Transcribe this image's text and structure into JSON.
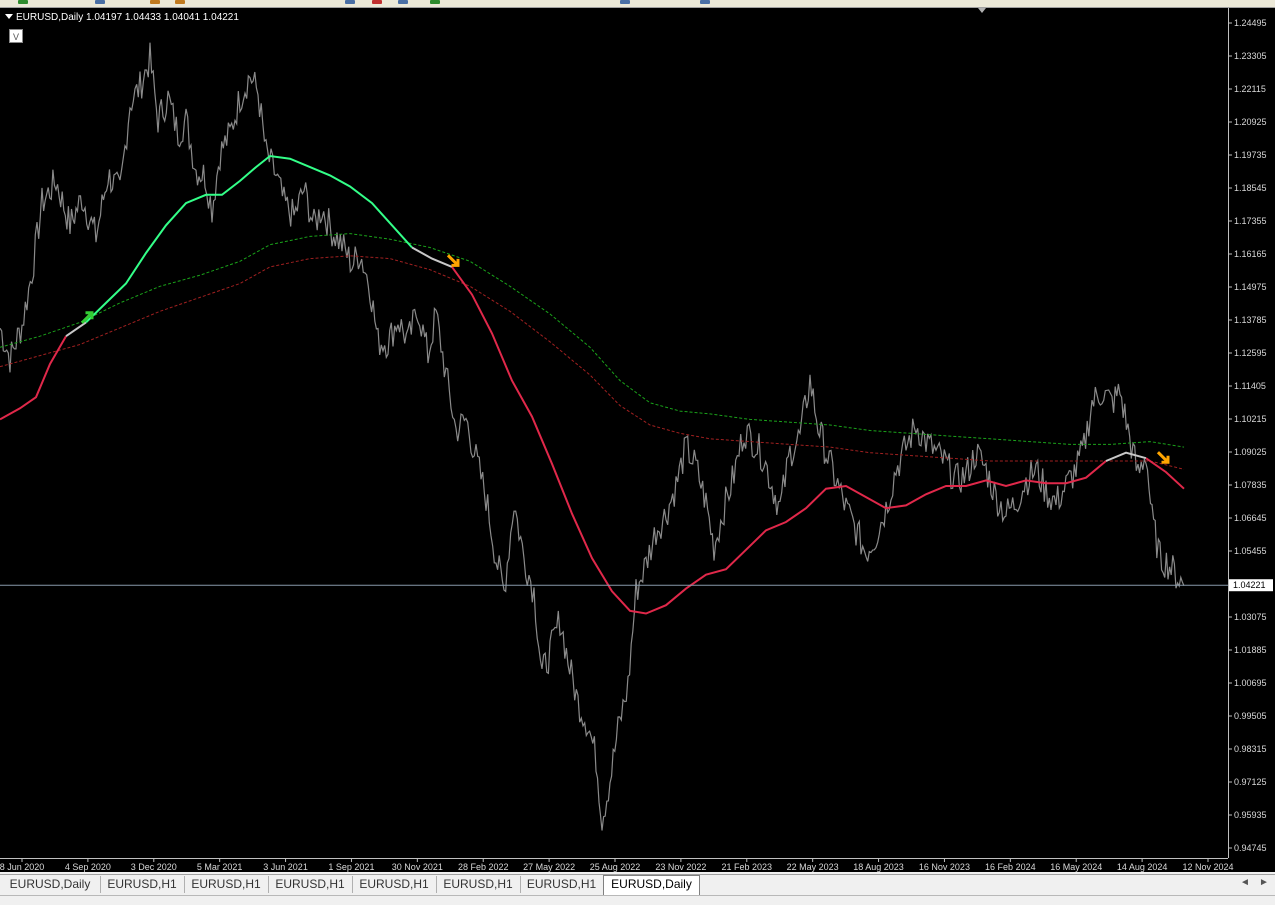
{
  "toolbar": {
    "icons": [
      {
        "name": "new-order-icon",
        "color": "#2e8b2e"
      },
      {
        "name": "open-chart-icon",
        "color": "#4a6fa5"
      },
      {
        "name": "profiles-icon",
        "color": "#c07a20"
      },
      {
        "name": "navigator-icon",
        "color": "#c07a20"
      },
      {
        "name": "market-watch-icon",
        "color": "#4a6fa5"
      },
      {
        "name": "data-window-icon",
        "color": "#c03030"
      },
      {
        "name": "terminal-icon",
        "color": "#4a6fa5"
      },
      {
        "name": "tester-icon",
        "color": "#2e8b2e"
      },
      {
        "name": "zoom-in-icon",
        "color": "#4a6fa5"
      },
      {
        "name": "zoom-out-icon",
        "color": "#4a6fa5"
      }
    ]
  },
  "chart": {
    "symbol_header": "EURUSD,Daily  1.04197 1.04433 1.04041 1.04221",
    "indicator_button": "V",
    "current_price_label": "1.04221",
    "colors": {
      "background": "#000000",
      "price": "#8a8a8a",
      "ma_up": "#33ff88",
      "ma_down": "#e0284a",
      "ma_neutral": "#c8c8c8",
      "band_upper": "#1aa31a",
      "band_lower": "#a02020",
      "current_line": "#8899aa",
      "arrow_up": "#33cc33",
      "arrow_down": "#ffa500"
    }
  },
  "chart_data": {
    "type": "line",
    "title": "EURUSD,Daily",
    "y_ticks": [
      "1.24495",
      "1.23305",
      "1.22115",
      "1.20925",
      "1.19735",
      "1.18545",
      "1.17355",
      "1.16165",
      "1.14975",
      "1.13785",
      "1.12595",
      "1.11405",
      "1.10215",
      "1.09025",
      "1.07835",
      "1.06645",
      "1.05455",
      "1.03075",
      "1.01885",
      "1.00695",
      "0.99505",
      "0.98315",
      "0.97125",
      "0.95935",
      "0.94745"
    ],
    "x_ticks": [
      "8 Jun 2020",
      "4 Sep 2020",
      "3 Dec 2020",
      "5 Mar 2021",
      "3 Jun 2021",
      "1 Sep 2021",
      "30 Nov 2021",
      "28 Feb 2022",
      "27 May 2022",
      "25 Aug 2022",
      "23 Nov 2022",
      "21 Feb 2023",
      "22 May 2023",
      "18 Aug 2023",
      "16 Nov 2023",
      "16 Feb 2024",
      "16 May 2024",
      "14 Aug 2024",
      "12 Nov 2024"
    ],
    "ylim": [
      0.94745,
      1.24495
    ],
    "last_close": 1.04221,
    "series": [
      {
        "values": [
          [
            0,
            1.135
          ],
          [
            10,
            1.124
          ],
          [
            22,
            1.136
          ],
          [
            32,
            1.155
          ],
          [
            42,
            1.18
          ],
          [
            56,
            1.188
          ],
          [
            70,
            1.172
          ],
          [
            82,
            1.182
          ],
          [
            96,
            1.168
          ],
          [
            108,
            1.19
          ],
          [
            120,
            1.184
          ],
          [
            130,
            1.216
          ],
          [
            140,
            1.222
          ],
          [
            150,
            1.232
          ],
          [
            158,
            1.21
          ],
          [
            168,
            1.218
          ],
          [
            178,
            1.205
          ],
          [
            186,
            1.21
          ],
          [
            196,
            1.192
          ],
          [
            205,
            1.19
          ],
          [
            212,
            1.178
          ],
          [
            220,
            1.198
          ],
          [
            230,
            1.205
          ],
          [
            240,
            1.218
          ],
          [
            250,
            1.226
          ],
          [
            258,
            1.22
          ],
          [
            266,
            1.198
          ],
          [
            276,
            1.19
          ],
          [
            284,
            1.18
          ],
          [
            294,
            1.175
          ],
          [
            304,
            1.185
          ],
          [
            314,
            1.172
          ],
          [
            322,
            1.178
          ],
          [
            332,
            1.17
          ],
          [
            342,
            1.165
          ],
          [
            352,
            1.158
          ],
          [
            360,
            1.162
          ],
          [
            370,
            1.15
          ],
          [
            378,
            1.13
          ],
          [
            388,
            1.13
          ],
          [
            398,
            1.138
          ],
          [
            408,
            1.13
          ],
          [
            418,
            1.142
          ],
          [
            428,
            1.125
          ],
          [
            436,
            1.14
          ],
          [
            446,
            1.118
          ],
          [
            456,
            1.098
          ],
          [
            466,
            1.102
          ],
          [
            476,
            1.088
          ],
          [
            486,
            1.074
          ],
          [
            496,
            1.052
          ],
          [
            504,
            1.04
          ],
          [
            514,
            1.072
          ],
          [
            524,
            1.052
          ],
          [
            534,
            1.04
          ],
          [
            542,
            1.01
          ],
          [
            550,
            1.018
          ],
          [
            560,
            1.03
          ],
          [
            568,
            1.015
          ],
          [
            578,
            1.0
          ],
          [
            588,
            0.992
          ],
          [
            596,
            0.98
          ],
          [
            602,
            0.958
          ],
          [
            610,
            0.972
          ],
          [
            618,
            0.99
          ],
          [
            628,
            1.006
          ],
          [
            636,
            1.04
          ],
          [
            646,
            1.05
          ],
          [
            656,
            1.062
          ],
          [
            666,
            1.068
          ],
          [
            676,
            1.078
          ],
          [
            686,
            1.092
          ],
          [
            696,
            1.085
          ],
          [
            706,
            1.072
          ],
          [
            714,
            1.056
          ],
          [
            724,
            1.07
          ],
          [
            734,
            1.082
          ],
          [
            744,
            1.098
          ],
          [
            754,
            1.094
          ],
          [
            764,
            1.088
          ],
          [
            772,
            1.078
          ],
          [
            780,
            1.07
          ],
          [
            790,
            1.09
          ],
          [
            800,
            1.096
          ],
          [
            810,
            1.116
          ],
          [
            818,
            1.1
          ],
          [
            826,
            1.09
          ],
          [
            836,
            1.08
          ],
          [
            846,
            1.07
          ],
          [
            856,
            1.062
          ],
          [
            866,
            1.054
          ],
          [
            876,
            1.06
          ],
          [
            886,
            1.07
          ],
          [
            896,
            1.084
          ],
          [
            906,
            1.092
          ],
          [
            916,
            1.1
          ],
          [
            926,
            1.094
          ],
          [
            936,
            1.09
          ],
          [
            946,
            1.086
          ],
          [
            956,
            1.08
          ],
          [
            966,
            1.082
          ],
          [
            976,
            1.09
          ],
          [
            986,
            1.084
          ],
          [
            996,
            1.074
          ],
          [
            1006,
            1.068
          ],
          [
            1016,
            1.072
          ],
          [
            1026,
            1.08
          ],
          [
            1036,
            1.084
          ],
          [
            1046,
            1.076
          ],
          [
            1056,
            1.072
          ],
          [
            1066,
            1.078
          ],
          [
            1076,
            1.084
          ],
          [
            1084,
            1.092
          ],
          [
            1092,
            1.108
          ],
          [
            1102,
            1.112
          ],
          [
            1112,
            1.108
          ],
          [
            1120,
            1.112
          ],
          [
            1128,
            1.098
          ],
          [
            1138,
            1.082
          ],
          [
            1146,
            1.09
          ],
          [
            1152,
            1.066
          ],
          [
            1160,
            1.052
          ],
          [
            1168,
            1.05
          ],
          [
            1176,
            1.046
          ],
          [
            1184,
            1.042
          ]
        ]
      },
      {
        "values": [
          [
            0,
            1.102
          ],
          [
            20,
            1.106
          ],
          [
            36,
            1.11
          ],
          [
            50,
            1.122
          ],
          [
            66,
            1.132
          ],
          [
            86,
            1.137
          ],
          [
            106,
            1.144
          ],
          [
            126,
            1.151
          ],
          [
            146,
            1.162
          ],
          [
            166,
            1.172
          ],
          [
            186,
            1.18
          ],
          [
            206,
            1.183
          ],
          [
            222,
            1.183
          ],
          [
            240,
            1.188
          ],
          [
            256,
            1.193
          ],
          [
            270,
            1.197
          ],
          [
            290,
            1.196
          ],
          [
            310,
            1.193
          ],
          [
            330,
            1.19
          ],
          [
            350,
            1.186
          ],
          [
            372,
            1.18
          ],
          [
            392,
            1.172
          ],
          [
            412,
            1.164
          ],
          [
            432,
            1.16
          ],
          [
            452,
            1.157
          ],
          [
            472,
            1.147
          ],
          [
            492,
            1.133
          ],
          [
            512,
            1.116
          ],
          [
            532,
            1.103
          ],
          [
            552,
            1.086
          ],
          [
            572,
            1.068
          ],
          [
            592,
            1.052
          ],
          [
            612,
            1.04
          ],
          [
            630,
            1.033
          ],
          [
            646,
            1.032
          ],
          [
            666,
            1.035
          ],
          [
            686,
            1.041
          ],
          [
            706,
            1.046
          ],
          [
            726,
            1.048
          ],
          [
            746,
            1.055
          ],
          [
            766,
            1.062
          ],
          [
            786,
            1.065
          ],
          [
            806,
            1.07
          ],
          [
            826,
            1.077
          ],
          [
            846,
            1.078
          ],
          [
            866,
            1.074
          ],
          [
            886,
            1.07
          ],
          [
            906,
            1.071
          ],
          [
            926,
            1.075
          ],
          [
            946,
            1.078
          ],
          [
            966,
            1.078
          ],
          [
            986,
            1.08
          ],
          [
            1006,
            1.078
          ],
          [
            1026,
            1.08
          ],
          [
            1046,
            1.079
          ],
          [
            1066,
            1.079
          ],
          [
            1086,
            1.081
          ],
          [
            1106,
            1.087
          ],
          [
            1126,
            1.09
          ],
          [
            1146,
            1.088
          ],
          [
            1166,
            1.083
          ],
          [
            1184,
            1.077
          ]
        ]
      },
      {
        "values": [
          [
            0,
            1.128
          ],
          [
            40,
            1.132
          ],
          [
            80,
            1.137
          ],
          [
            120,
            1.144
          ],
          [
            160,
            1.15
          ],
          [
            200,
            1.154
          ],
          [
            240,
            1.159
          ],
          [
            270,
            1.165
          ],
          [
            310,
            1.168
          ],
          [
            350,
            1.169
          ],
          [
            390,
            1.167
          ],
          [
            430,
            1.164
          ],
          [
            470,
            1.159
          ],
          [
            510,
            1.15
          ],
          [
            550,
            1.14
          ],
          [
            590,
            1.128
          ],
          [
            620,
            1.116
          ],
          [
            650,
            1.108
          ],
          [
            680,
            1.105
          ],
          [
            710,
            1.104
          ],
          [
            750,
            1.102
          ],
          [
            790,
            1.101
          ],
          [
            830,
            1.1
          ],
          [
            870,
            1.098
          ],
          [
            910,
            1.097
          ],
          [
            950,
            1.096
          ],
          [
            990,
            1.095
          ],
          [
            1030,
            1.094
          ],
          [
            1070,
            1.093
          ],
          [
            1110,
            1.093
          ],
          [
            1150,
            1.094
          ],
          [
            1184,
            1.092
          ]
        ]
      },
      {
        "values": [
          [
            0,
            1.121
          ],
          [
            40,
            1.125
          ],
          [
            80,
            1.129
          ],
          [
            120,
            1.135
          ],
          [
            160,
            1.141
          ],
          [
            200,
            1.146
          ],
          [
            240,
            1.151
          ],
          [
            270,
            1.157
          ],
          [
            310,
            1.16
          ],
          [
            350,
            1.161
          ],
          [
            390,
            1.16
          ],
          [
            430,
            1.156
          ],
          [
            470,
            1.15
          ],
          [
            510,
            1.141
          ],
          [
            550,
            1.13
          ],
          [
            590,
            1.118
          ],
          [
            620,
            1.107
          ],
          [
            650,
            1.1
          ],
          [
            680,
            1.097
          ],
          [
            710,
            1.095
          ],
          [
            750,
            1.094
          ],
          [
            790,
            1.093
          ],
          [
            830,
            1.092
          ],
          [
            870,
            1.09
          ],
          [
            910,
            1.089
          ],
          [
            950,
            1.088
          ],
          [
            990,
            1.087
          ],
          [
            1030,
            1.087
          ],
          [
            1070,
            1.087
          ],
          [
            1110,
            1.087
          ],
          [
            1150,
            1.087
          ],
          [
            1184,
            1.084
          ]
        ]
      }
    ],
    "signals": [
      {
        "type": "up",
        "x": 88,
        "y": 1.139
      },
      {
        "type": "down",
        "x": 454,
        "y": 1.159
      },
      {
        "type": "down",
        "x": 1164,
        "y": 1.088
      }
    ]
  },
  "tabs": [
    {
      "label": "EURUSD,Daily",
      "active": false
    },
    {
      "label": "EURUSD,H1",
      "active": false
    },
    {
      "label": "EURUSD,H1",
      "active": false
    },
    {
      "label": "EURUSD,H1",
      "active": false
    },
    {
      "label": "EURUSD,H1",
      "active": false
    },
    {
      "label": "EURUSD,H1",
      "active": false
    },
    {
      "label": "EURUSD,H1",
      "active": false
    },
    {
      "label": "EURUSD,Daily",
      "active": true
    }
  ],
  "tab_scroll": {
    "left": "◄",
    "right": "►"
  }
}
